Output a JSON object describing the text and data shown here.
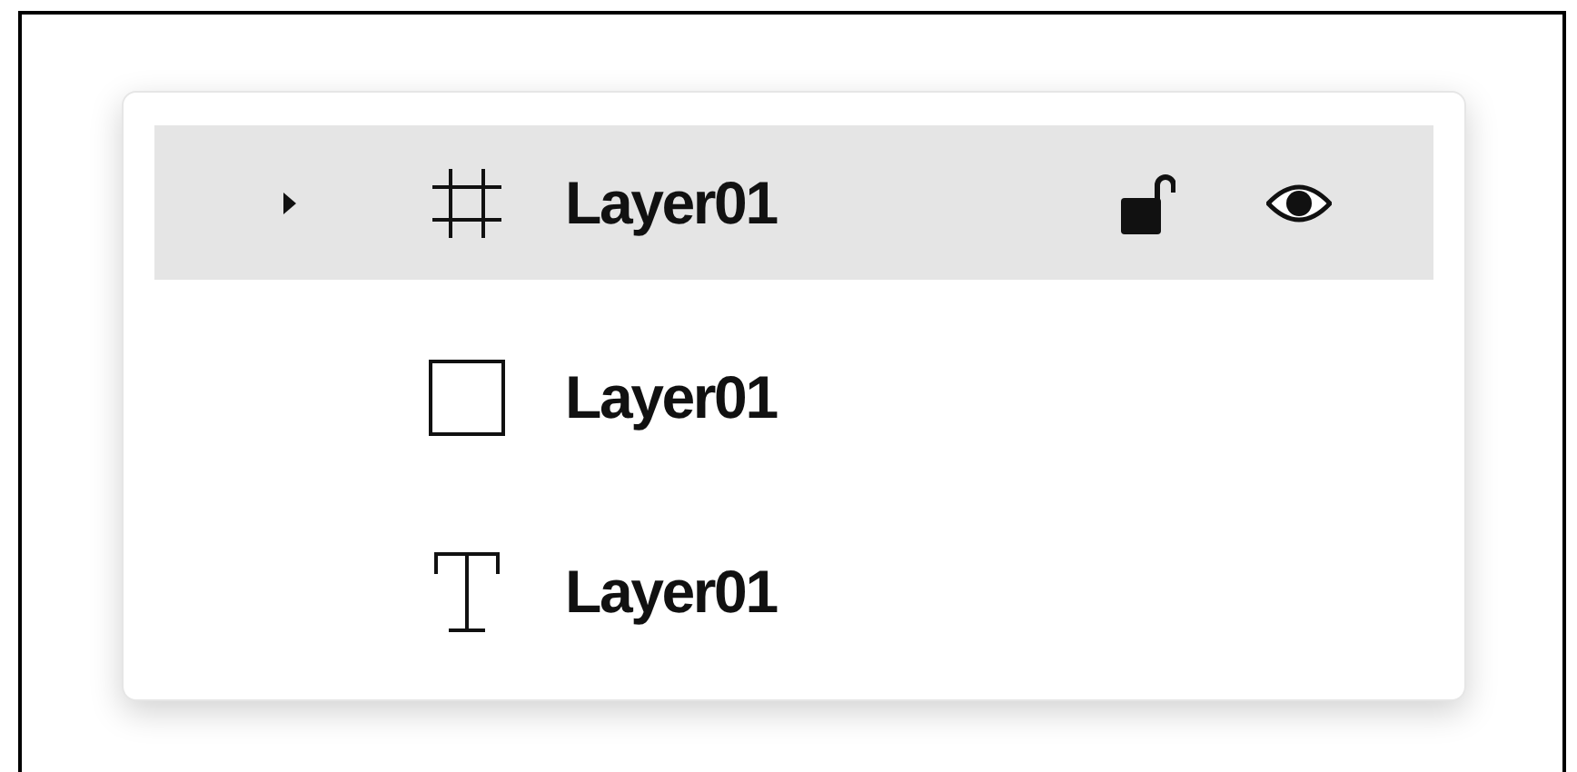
{
  "layers": [
    {
      "kind": "frame",
      "name": "Layer01",
      "selected": true,
      "expanded": false,
      "locked": false,
      "visible": true
    },
    {
      "kind": "rectangle",
      "name": "Layer01",
      "selected": false
    },
    {
      "kind": "text",
      "name": "Layer01",
      "selected": false
    }
  ]
}
